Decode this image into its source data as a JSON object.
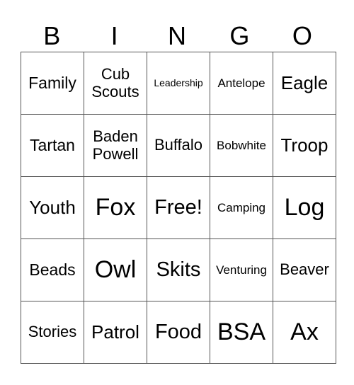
{
  "header": [
    "B",
    "I",
    "N",
    "G",
    "O"
  ],
  "rows": [
    [
      "Family",
      "Cub Scouts",
      "Leadership",
      "Antelope",
      "Eagle"
    ],
    [
      "Tartan",
      "Baden Powell",
      "Buffalo",
      "Bobwhite",
      "Troop"
    ],
    [
      "Youth",
      "Fox",
      "Free!",
      "Camping",
      "Log"
    ],
    [
      "Beads",
      "Owl",
      "Skits",
      "Venturing",
      "Beaver"
    ],
    [
      "Stories",
      "Patrol",
      "Food",
      "BSA",
      "Ax"
    ]
  ]
}
